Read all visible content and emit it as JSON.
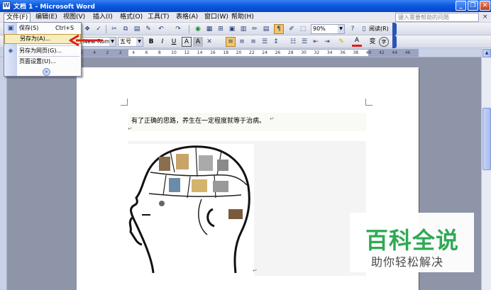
{
  "window": {
    "title": "文档 1 - Microsoft Word",
    "app_icon": "W",
    "minimize_glyph": "_",
    "restore_glyph": "❐",
    "close_glyph": "✕"
  },
  "menubar": {
    "items": [
      "文件(F)",
      "编辑(E)",
      "视图(V)",
      "插入(I)",
      "格式(O)",
      "工具(T)",
      "表格(A)",
      "窗口(W)",
      "帮助(H)"
    ],
    "help_placeholder": "键入需要帮助的问题",
    "close_glyph": "×"
  },
  "file_menu": {
    "items": [
      {
        "label": "保存(S)",
        "shortcut": "Ctrl+S",
        "icon": "save-icon"
      },
      {
        "label": "另存为(A)...",
        "shortcut": "",
        "icon": "none"
      },
      {
        "label": "另存为网页(G)...",
        "shortcut": "",
        "icon": "web-page-icon"
      },
      {
        "label": "页面设置(U)...",
        "shortcut": "",
        "icon": "none"
      }
    ],
    "highlighted": "另存为(A)...",
    "expand_glyph": "»"
  },
  "toolbar_standard": {
    "traditional_chinese": "繁",
    "zoom": "90%",
    "reading_mode": "阅读(R)"
  },
  "toolbar_format": {
    "font_name": "New Roman",
    "font_size": "五号",
    "bold": "B",
    "italic": "I",
    "underline": "U",
    "char_border": "A",
    "char_shading": "A",
    "font_color": "A",
    "phonetic": "变",
    "enclose": "字"
  },
  "ruler": {
    "ticks": [
      "6",
      "4",
      "2",
      "2",
      "4",
      "6",
      "8",
      "10",
      "12",
      "14",
      "16",
      "18",
      "20",
      "22",
      "24",
      "26",
      "28",
      "30",
      "32",
      "34",
      "36",
      "38",
      "40",
      "42",
      "44",
      "46"
    ]
  },
  "document": {
    "sentence": "有了正确的思路，养生在一定程度就等于治病。",
    "paragraph_mark": "↵"
  },
  "watermark": {
    "brand": "百科全说",
    "slogan": "助你轻松解决"
  },
  "colors": {
    "title_blue": "#0a5ae0",
    "watermark_green": "#2faa55",
    "arrow_red": "#d92020",
    "highlight": "#f7edbf"
  }
}
